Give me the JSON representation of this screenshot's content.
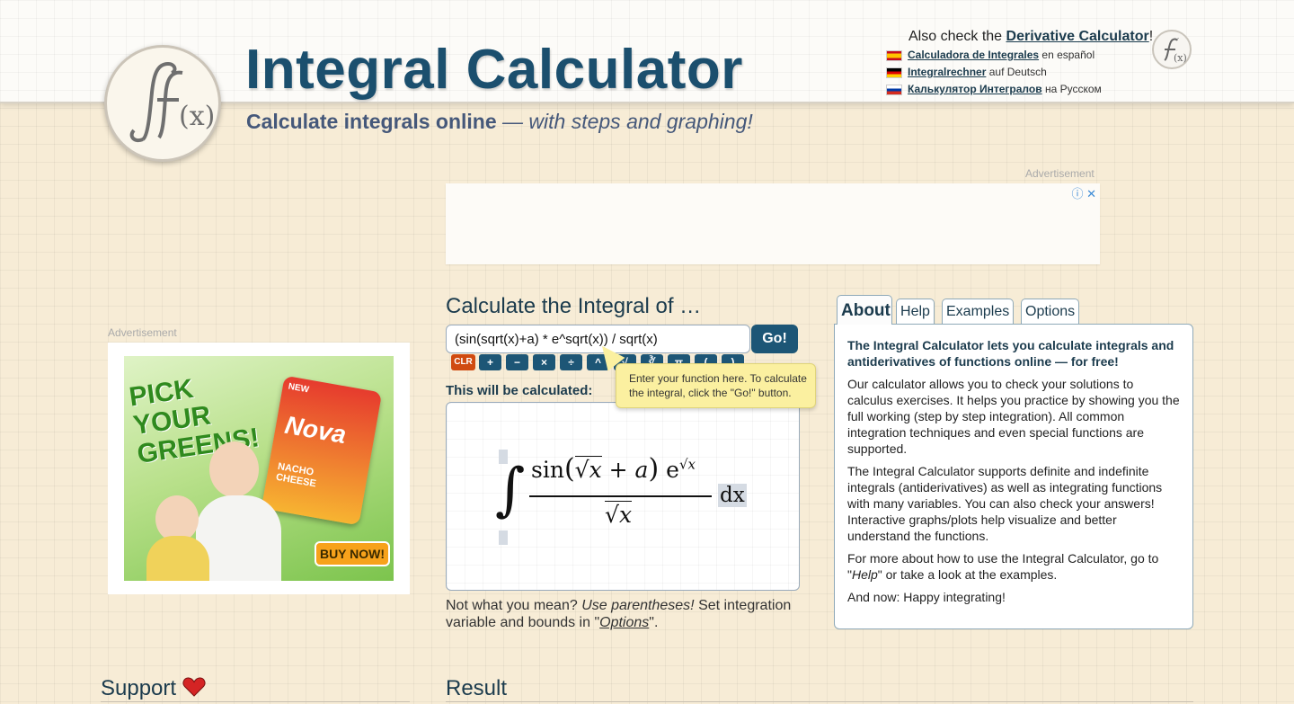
{
  "header": {
    "title": "Integral Calculator",
    "tagline_bold": "Calculate integrals online",
    "tagline_italic": "— with steps and graphing!",
    "also_check_prefix": "Also check the",
    "also_check_link": "Derivative Calculator",
    "also_check_suffix": "!",
    "languages": [
      {
        "flag": "spain",
        "link": "Calculadora de Integrales",
        "suffix": "en español"
      },
      {
        "flag": "germany",
        "link": "Integralrechner",
        "suffix": "auf Deutsch"
      },
      {
        "flag": "russia",
        "link": "Калькулятор Интегралов",
        "suffix": "на Русском"
      }
    ]
  },
  "ads": {
    "label": "Advertisement",
    "banner": {
      "headline": "PICK YOUR GREENS!",
      "badge": "NEW",
      "brand": "Nova",
      "flavor": "NACHO CHEESE",
      "cta": "BUY NOW!"
    }
  },
  "calculator": {
    "heading": "Calculate the Integral of …",
    "input_value": "(sin(sqrt(x)+a) * e^sqrt(x)) / sqrt(x)",
    "go_label": "Go!",
    "toolbar": [
      "CLR",
      "+",
      "−",
      "×",
      "÷",
      "^",
      "√",
      "∛",
      "π",
      "(",
      ")"
    ],
    "tooltip": "Enter your function here. To calculate the integral, click the \"Go!\" button.",
    "will_calc_label": "This will be calculated:",
    "preview": {
      "integral": "∫",
      "numerator_sin": "sin",
      "numerator_x": "x",
      "numerator_plus_a": "+ a",
      "numerator_e": "e",
      "exponent_x": "x",
      "denominator_x": "x",
      "differential": "dx"
    },
    "note_plain1": "Not what you mean?",
    "note_italic": "Use parentheses!",
    "note_plain2": "Set integration variable and bounds in \"",
    "note_link": "Options",
    "note_end": "\"."
  },
  "tabs": [
    {
      "label": "About",
      "active": true
    },
    {
      "label": "Help",
      "active": false
    },
    {
      "label": "Examples",
      "active": false
    },
    {
      "label": "Options",
      "active": false
    }
  ],
  "about": {
    "lead": "The Integral Calculator lets you calculate integrals and antiderivatives of functions online — for free!",
    "p1": "Our calculator allows you to check your solutions to calculus exercises. It helps you practice by showing you the full working (step by step integration). All common integration techniques and even special functions are supported.",
    "p2": "The Integral Calculator supports definite and indefinite integrals (antiderivatives) as well as integrating functions with many variables. You can also check your answers! Interactive graphs/plots help visualize and better understand the functions.",
    "p3_prefix": "For more about how to use the Integral Calculator, go to \"",
    "p3_link": "Help",
    "p3_suffix": "\" or take a look at the examples.",
    "p4": "And now: Happy integrating!"
  },
  "sections": {
    "support": "Support",
    "result": "Result"
  },
  "colors": {
    "accent": "#1d5676",
    "title": "#1b4f6e",
    "clear": "#d04a10",
    "tooltip": "#fbf0a0"
  }
}
